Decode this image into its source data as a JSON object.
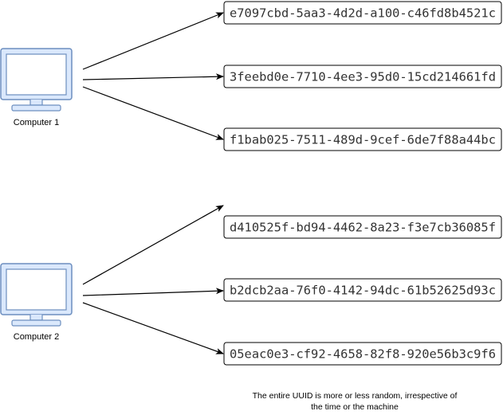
{
  "colors": {
    "monitor_fill": "#dae8fc",
    "monitor_stroke": "#6c8ebf",
    "box_stroke": "#000000",
    "text": "#333333"
  },
  "computers": [
    {
      "label": "Computer 1",
      "uuids": [
        "e7097cbd-5aa3-4d2d-a100-c46fd8b4521c",
        "3feebd0e-7710-4ee3-95d0-15cd214661fd",
        "f1bab025-7511-489d-9cef-6de7f88a44bc"
      ]
    },
    {
      "label": "Computer 2",
      "uuids": [
        "d410525f-bd94-4462-8a23-f3e7cb36085f",
        "b2dcb2aa-76f0-4142-94dc-61b52625d93c",
        "05eac0e3-cf92-4658-82f8-920e56b3c9f6"
      ]
    }
  ],
  "note": {
    "line1": "The entire UUID is more or less random, irrespective of",
    "line2": "the time or the machine"
  }
}
